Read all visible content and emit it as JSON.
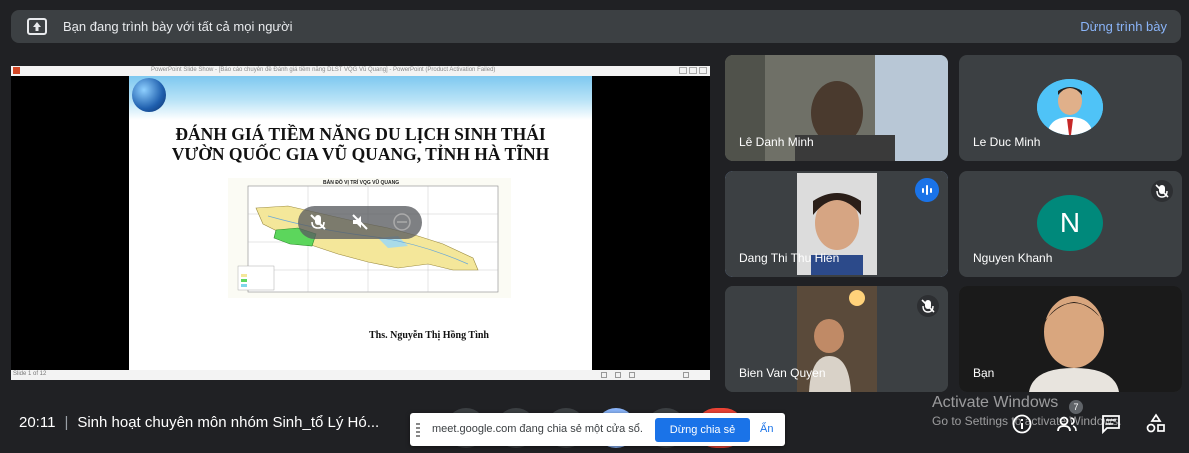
{
  "banner": {
    "text": "Bạn đang trình bày với tất cả mọi người",
    "stop_label": "Dừng trình bày"
  },
  "slide": {
    "window_title": "PowerPoint Slide Show - [Báo cáo chuyên đề Đánh giá tiềm năng DLST VQG Vũ Quang] - PowerPoint (Product Activation Failed)",
    "title_line1": "ĐÁNH GIÁ TIỀM NĂNG DU LỊCH SINH THÁI",
    "title_line2": "VƯỜN QUỐC GIA VŨ QUANG, TỈNH HÀ TĨNH",
    "map_title": "BẢN ĐỒ VỊ TRÍ VQG VŨ QUANG",
    "author": "Ths. Nguyễn Thị Hồng Tình",
    "status": "Slide 1 of 12"
  },
  "participants": [
    {
      "name": "Lê Danh Minh",
      "state": "video"
    },
    {
      "name": "Le Duc Minh",
      "state": "avatar"
    },
    {
      "name": "Dang Thi Thu Hien",
      "state": "speaking"
    },
    {
      "name": "Nguyen Khanh",
      "state": "muted",
      "initial": "N"
    },
    {
      "name": "Bien Van Quyen",
      "state": "muted"
    },
    {
      "name": "Bạn",
      "state": "video"
    }
  ],
  "meeting": {
    "time": "20:11",
    "title": "Sinh hoạt chuyên môn nhóm Sinh_tổ Lý Hó..."
  },
  "share_notice": {
    "message": "meet.google.com đang chia sẻ một cửa sổ.",
    "stop_label": "Dừng chia sẻ",
    "hide_label": "Ẩn"
  },
  "people_count": "7",
  "watermark": {
    "line1": "Activate Windows",
    "line2": "Go to Settings to activate Windows."
  },
  "colors": {
    "accent": "#8ab4f8",
    "primary_button": "#1a73e8",
    "end_call": "#ea4335",
    "avatar_n": "#00897b"
  }
}
